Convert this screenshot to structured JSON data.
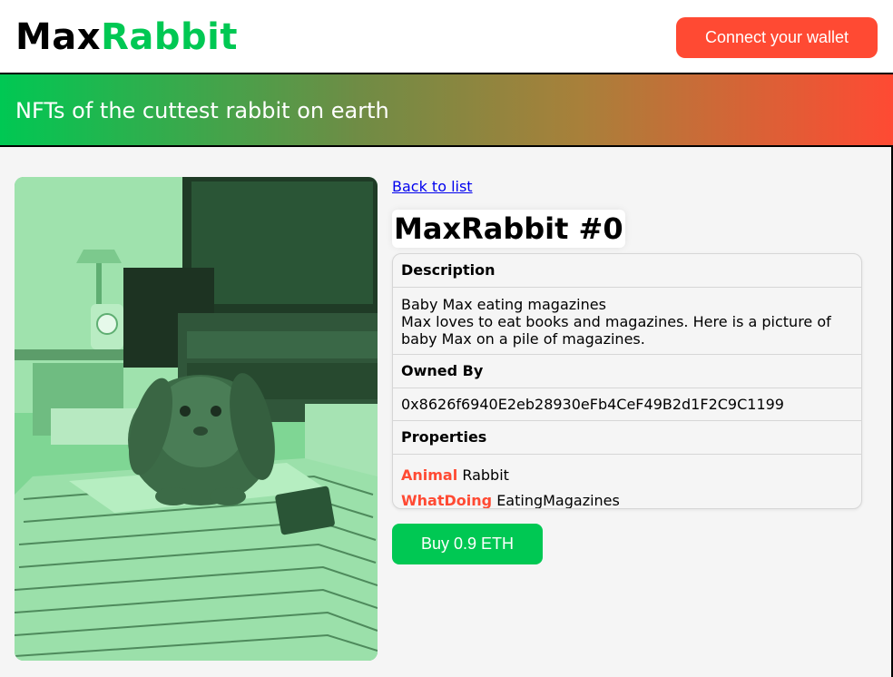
{
  "header": {
    "logo_part1": "Max",
    "logo_part2": "Rabbit",
    "connect_label": "Connect your wallet"
  },
  "banner": {
    "tagline": "NFTs of the cuttest rabbit on earth"
  },
  "nft": {
    "back_label": "Back to list",
    "title": "MaxRabbit #0",
    "description_header": "Description",
    "description_title": "Baby Max eating magazines",
    "description_text": "Max loves to eat books and magazines. Here is a picture of baby Max on a pile of magazines.",
    "owned_by_header": "Owned By",
    "owner_address": "0x8626f6940E2eb28930eFb4CeF49B2d1F2C9C1199",
    "properties_header": "Properties",
    "properties": [
      {
        "key": "Animal",
        "value": "Rabbit"
      },
      {
        "key": "WhatDoing",
        "value": "EatingMagazines"
      }
    ],
    "buy_label": "Buy 0.9 ETH"
  },
  "colors": {
    "brand_green": "#00c853",
    "accent_red": "#ff4a33",
    "link_blue": "#0000ee"
  }
}
